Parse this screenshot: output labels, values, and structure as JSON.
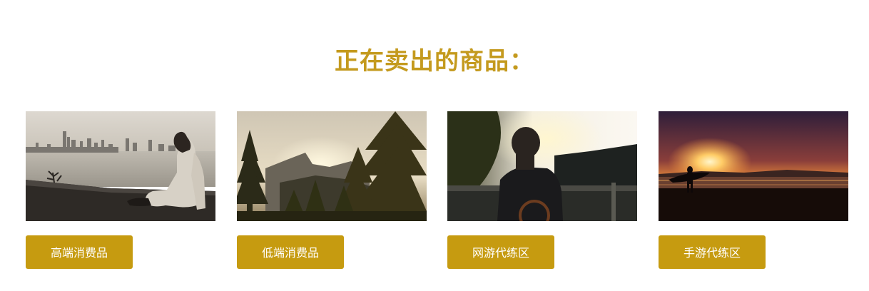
{
  "page": {
    "title": "正在卖出的商品："
  },
  "products": [
    {
      "label": "高端消费品",
      "image": "man-by-lake-city-skyline-photo"
    },
    {
      "label": "低端消费品",
      "image": "forest-mountain-sunset-photo"
    },
    {
      "label": "网游代练区",
      "image": "man-at-railing-sunlight-photo"
    },
    {
      "label": "手游代练区",
      "image": "surfer-silhouette-sunset-photo"
    }
  ],
  "colors": {
    "accent": "#c69b10",
    "title": "#c49a1e",
    "button_text": "#ffffff"
  }
}
